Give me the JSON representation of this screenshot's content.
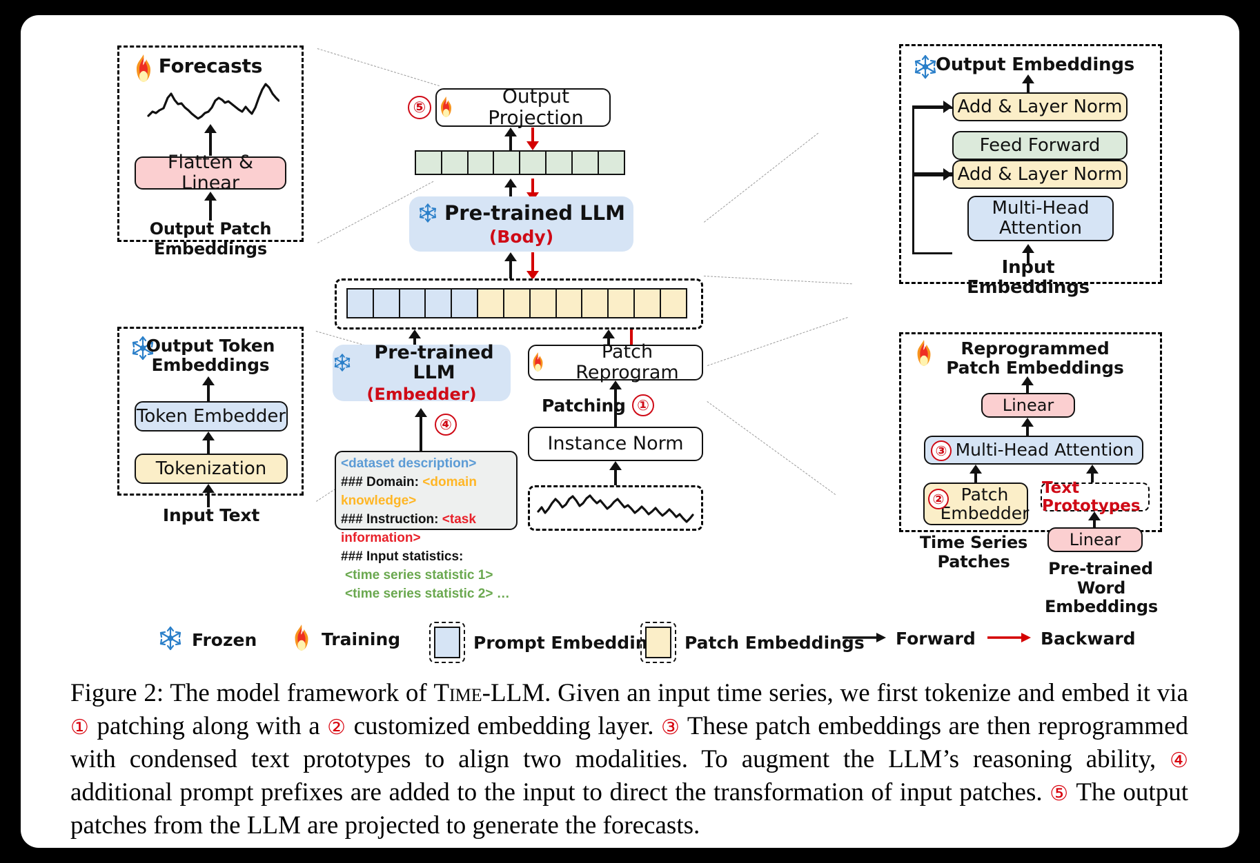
{
  "figure": {
    "caption_prefix": "Figure 2:",
    "caption_segments": [
      "The model framework of ",
      "Time-LLM",
      ". Given an input time series, we first tokenize and embed it via ",
      "patching along with a ",
      "customized embedding layer. ",
      "These patch embeddings are then reprogrammed with condensed text prototypes to align two modalities. To augment the LLM’s reasoning ability, ",
      "additional prompt prefixes are added to the input to direct the transformation of input patches. ",
      "The output patches from the LLM are projected to generate the forecasts."
    ],
    "caption_numbers": [
      "①",
      "②",
      "③",
      "④",
      "⑤"
    ]
  },
  "panel_forecast": {
    "title": "Forecasts",
    "icon": "fire-icon",
    "box_label": "Flatten & Linear",
    "input_label_line1": "Output Patch",
    "input_label_line2": "Embeddings"
  },
  "panel_token": {
    "icon": "snowflake-icon",
    "title_line1": "Output Token",
    "title_line2": "Embeddings",
    "box_top": "Token Embedder",
    "box_bottom": "Tokenization",
    "input_label": "Input Text"
  },
  "panel_transformer": {
    "icon": "snowflake-icon",
    "title": "Output Embeddings",
    "blocks": [
      {
        "label": "Add & Layer Norm",
        "color": "yellow"
      },
      {
        "label": "Feed Forward",
        "color": "green"
      },
      {
        "label": "Add & Layer Norm",
        "color": "yellow"
      },
      {
        "label": "Multi-Head Attention",
        "color": "blue"
      }
    ],
    "input_label": "Input Embeddings"
  },
  "panel_reprogram": {
    "icon": "fire-icon",
    "title_line1": "Reprogrammed",
    "title_line2": "Patch Embeddings",
    "linear_top": "Linear",
    "attention": "Multi-Head Attention",
    "attention_num": "③",
    "patch_embedder_line1": "Patch",
    "patch_embedder_line2": "Embedder",
    "patch_embedder_num": "②",
    "text_prototypes": "Text Prototypes",
    "linear_bottom": "Linear",
    "caption_left_line1": "Time Series",
    "caption_left_line2": "Patches",
    "caption_right_line1": "Pre-trained",
    "caption_right_line2": "Word Embeddings"
  },
  "center": {
    "output_projection": "Output Projection",
    "output_projection_num": "⑤",
    "llm_body_title": "Pre-trained LLM",
    "llm_body_sub": "(Body)",
    "llm_embedder_title": "Pre-trained LLM",
    "llm_embedder_sub": "(Embedder)",
    "llm_embedder_num": "④",
    "patch_reprogram": "Patch Reprogram",
    "patching_label": "Patching",
    "patching_num": "①",
    "instance_norm": "Instance Norm",
    "snowflake_icon": "snowflake-icon",
    "fire_icon": "fire-icon",
    "output_strip_cells": 8,
    "prompt_cells": 5,
    "patch_cells": 8
  },
  "prompt_box": {
    "line1": "<dataset description>",
    "line2_key": "### Domain:",
    "line2_val": "<domain knowledge>",
    "line3_key": "### Instruction:",
    "line3_val": "<task information>",
    "line4_key": "### Input statistics:",
    "line5": "<time series statistic 1>",
    "line6": "<time series statistic 2>",
    "line6_ellipsis": "…"
  },
  "legend": {
    "frozen": "Frozen",
    "training": "Training",
    "prompt_embeddings": "Prompt Embeddings",
    "patch_embeddings": "Patch Embeddings",
    "forward": "Forward",
    "backward": "Backward"
  },
  "colors": {
    "prompt_embedding": "#d6e4f5",
    "patch_embedding": "#fbeec8",
    "output_embedding": "#dceadb",
    "pink": "#fbcfd0",
    "red_accent": "#cf0a16",
    "backward_arrow": "#d40000",
    "snowflake_blue": "#2a7fc9"
  }
}
